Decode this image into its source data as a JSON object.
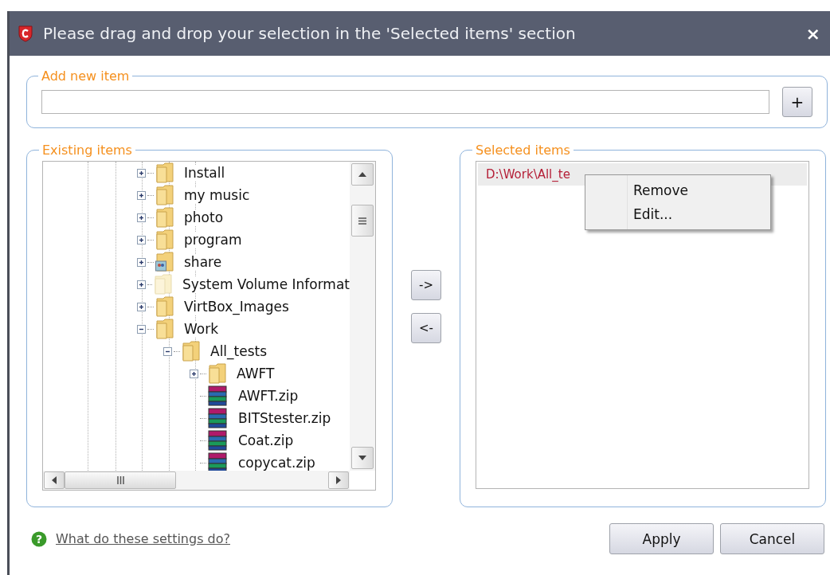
{
  "window": {
    "title": "Please drag and drop your selection in the 'Selected items' section",
    "close": "×"
  },
  "add_new_item": {
    "legend": "Add new item",
    "add_button": "+"
  },
  "existing_items": {
    "legend": "Existing items",
    "tree": [
      {
        "label": "Install",
        "kind": "folder",
        "expanded": false
      },
      {
        "label": "my music",
        "kind": "folder",
        "expanded": false
      },
      {
        "label": "photo",
        "kind": "folder",
        "expanded": false
      },
      {
        "label": "program",
        "kind": "folder",
        "expanded": false
      },
      {
        "label": "share",
        "kind": "shared",
        "expanded": false
      },
      {
        "label": "System Volume Informat",
        "kind": "hidden",
        "expanded": false
      },
      {
        "label": "VirtBox_Images",
        "kind": "folder",
        "expanded": false
      },
      {
        "label": "Work",
        "kind": "folder",
        "expanded": true,
        "children": [
          {
            "label": "All_tests",
            "kind": "folder",
            "expanded": true,
            "children": [
              {
                "label": "AWFT",
                "kind": "folder",
                "expanded": false
              },
              {
                "label": "AWFT.zip",
                "kind": "zip"
              },
              {
                "label": "BITStester.zip",
                "kind": "zip"
              },
              {
                "label": "Coat.zip",
                "kind": "zip"
              },
              {
                "label": "copycat.zip",
                "kind": "zip"
              }
            ]
          }
        ]
      }
    ]
  },
  "move_buttons": [
    "->",
    "<-"
  ],
  "selected_items": {
    "legend": "Selected items",
    "items": [
      {
        "text": "D:\\Work\\All_te",
        "selected": true
      }
    ]
  },
  "context_menu": [
    "Remove",
    "Edit..."
  ],
  "help_icon": "?",
  "help_link": "What do these settings do?",
  "buttons": [
    "Apply",
    "Cancel"
  ]
}
